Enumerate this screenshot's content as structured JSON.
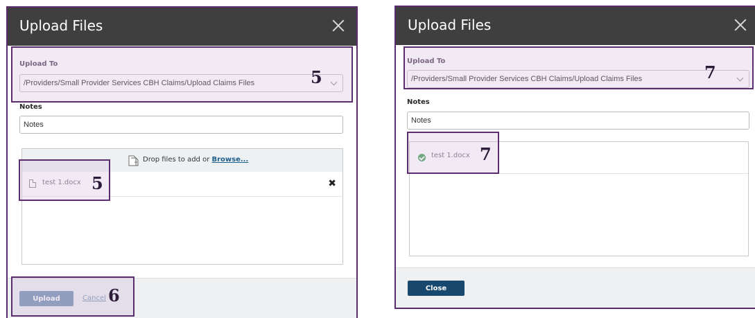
{
  "left_dialog": {
    "title": "Upload Files",
    "upload_to_label": "Upload To",
    "upload_to_value": "/Providers/Small Provider Services CBH Claims/Upload Claims Files",
    "notes_label": "Notes",
    "notes_placeholder": "Notes",
    "drop_text": "Drop files to add or ",
    "browse_label": "Browse...",
    "file_name": "test 1.docx",
    "remove_glyph": "✖",
    "upload_button": "Upload",
    "cancel_link": "Cancel",
    "step_upload_to": "5",
    "step_file": "5",
    "step_footer": "6"
  },
  "right_dialog": {
    "title": "Upload Files",
    "upload_to_label": "Upload To",
    "upload_to_value": "/Providers/Small Provider Services CBH Claims/Upload Claims Files",
    "notes_label": "Notes",
    "notes_placeholder": "Notes",
    "file_name": "test 1.docx",
    "close_button": "Close",
    "step_upload_to": "7",
    "step_file": "7"
  },
  "colors": {
    "header_bg": "#3f3f3f",
    "highlight_border": "#5b2d6e",
    "upload_button_bg": "#7b97b3",
    "close_button_bg": "#18486e",
    "success_check": "#4fa660"
  }
}
